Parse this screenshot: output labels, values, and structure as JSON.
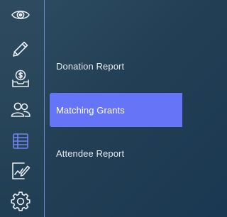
{
  "sidebar": {
    "icons": [
      {
        "name": "eye-icon",
        "active": false
      },
      {
        "name": "pencil-icon",
        "active": false
      },
      {
        "name": "donation-inbox-icon",
        "active": false
      },
      {
        "name": "people-icon",
        "active": false
      },
      {
        "name": "table-grid-icon",
        "active": true
      },
      {
        "name": "chart-document-icon",
        "active": false
      },
      {
        "name": "gear-icon",
        "active": false
      }
    ]
  },
  "submenu": {
    "items": [
      {
        "label": "Donation Report",
        "active": false
      },
      {
        "label": "Matching Grants",
        "active": true
      },
      {
        "label": "Attendee Report",
        "active": false
      }
    ]
  },
  "colors": {
    "background": "#233f55",
    "active_item": "#6675f7",
    "active_icon": "#6f86f0",
    "icon": "#e6ecf2",
    "text": "#e6ecf2"
  }
}
